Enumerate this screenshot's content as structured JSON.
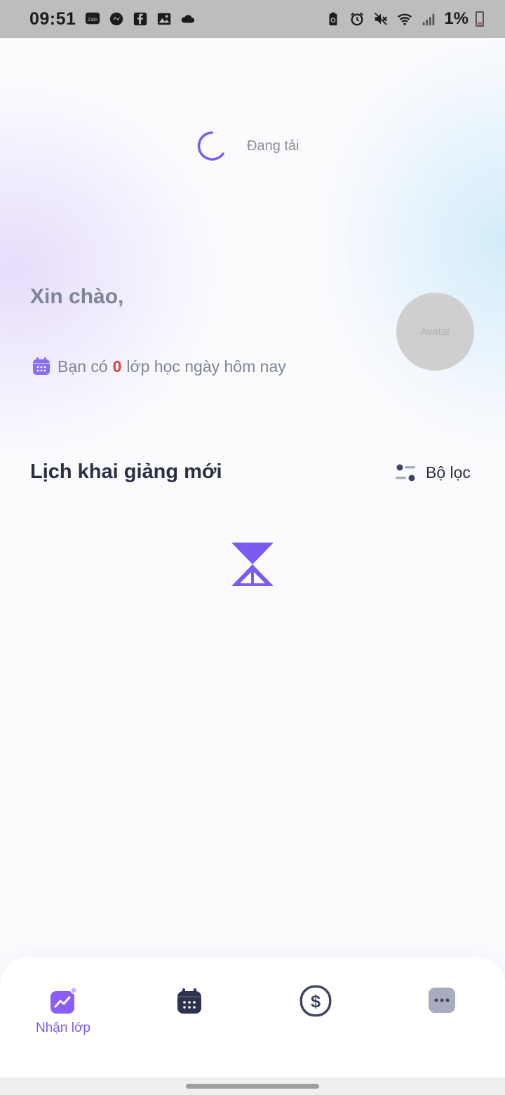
{
  "status_bar": {
    "time": "09:51",
    "left_icons": [
      "zalo-icon",
      "messenger-icon",
      "facebook-icon",
      "gallery-icon",
      "cloud-icon"
    ],
    "right_icons": [
      "battery-saver-icon",
      "alarm-icon",
      "mute-icon",
      "wifi-icon",
      "signal-icon"
    ],
    "battery_text": "1%"
  },
  "loading": {
    "text": "Đang tải"
  },
  "greeting": {
    "title": "Xin chào,",
    "prefix": "Bạn có",
    "count": "0",
    "suffix": "lớp học ngày hôm nay"
  },
  "avatar": {
    "label": "Avatar"
  },
  "section": {
    "title": "Lịch khai giảng mới",
    "filter_label": "Bộ lọc"
  },
  "bottom_nav": {
    "items": [
      {
        "label": "Nhận lớp",
        "icon": "chart-icon",
        "active": true
      },
      {
        "label": "",
        "icon": "calendar-icon",
        "active": false
      },
      {
        "label": "",
        "icon": "dollar-icon",
        "active": false
      },
      {
        "label": "",
        "icon": "more-icon",
        "active": false
      }
    ]
  },
  "colors": {
    "accent": "#7c5cf0",
    "count_red": "#e0453a",
    "title_dark": "#2a2f45",
    "muted_text": "#7d8597"
  }
}
